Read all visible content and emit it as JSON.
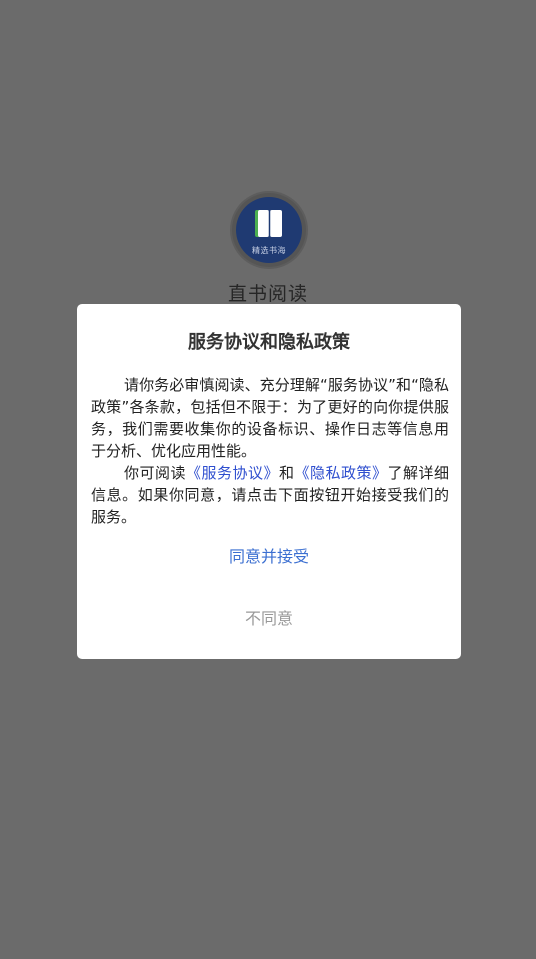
{
  "app": {
    "logo_caption": "精选书海",
    "name": "直书阅读",
    "logo_icon": "book-icon"
  },
  "dialog": {
    "title": "服务协议和隐私政策",
    "paragraph1": "请你务必审慎阅读、充分理解“服务协议”和“隐私政策”各条款，包括但不限于：为了更好的向你提供服务，我们需要收集你的设备标识、操作日志等信息用于分析、优化应用性能。",
    "paragraph2_prefix": "你可阅读",
    "link_service": "《服务协议》",
    "paragraph2_and": "和",
    "link_privacy": "《隐私政策》",
    "paragraph2_suffix": "了解详细信息。如果你同意，请点击下面按钮开始接受我们的服务。",
    "agree_label": "同意并接受",
    "disagree_label": "不同意"
  },
  "colors": {
    "overlay": "#6b6b6b",
    "link": "#2f4fcf",
    "agree": "#3b6fd1",
    "disagree": "#999999"
  }
}
